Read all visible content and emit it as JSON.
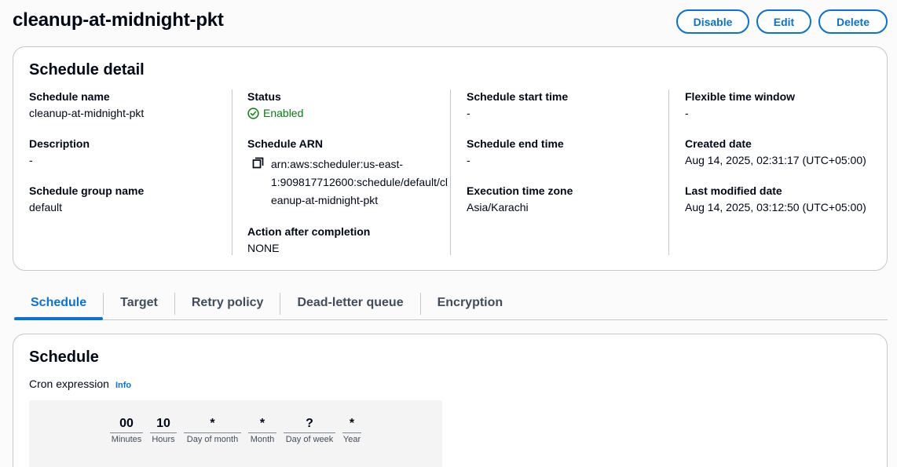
{
  "header": {
    "title": "cleanup-at-midnight-pkt",
    "disable_label": "Disable",
    "edit_label": "Edit",
    "delete_label": "Delete"
  },
  "detail": {
    "title": "Schedule detail",
    "schedule_name_label": "Schedule name",
    "schedule_name": "cleanup-at-midnight-pkt",
    "description_label": "Description",
    "description": "-",
    "group_label": "Schedule group name",
    "group": "default",
    "status_label": "Status",
    "status": "Enabled",
    "status_color": "#037f0c",
    "arn_label": "Schedule ARN",
    "arn_lines": [
      "arn:aws:scheduler:us-east-",
      "1:909817712600:schedule/default/cl",
      "eanup-at-midnight-pkt"
    ],
    "action_label": "Action after completion",
    "action": "NONE",
    "start_label": "Schedule start time",
    "start": "-",
    "end_label": "Schedule end time",
    "end": "-",
    "tz_label": "Execution time zone",
    "tz": "Asia/Karachi",
    "flex_label": "Flexible time window",
    "flex": "-",
    "created_label": "Created date",
    "created": "Aug 14, 2025, 02:31:17 (UTC+05:00)",
    "modified_label": "Last modified date",
    "modified": "Aug 14, 2025, 03:12:50 (UTC+05:00)"
  },
  "tabs": [
    {
      "label": "Schedule",
      "active": true
    },
    {
      "label": "Target"
    },
    {
      "label": "Retry policy"
    },
    {
      "label": "Dead-letter queue"
    },
    {
      "label": "Encryption"
    }
  ],
  "schedule": {
    "title": "Schedule",
    "cron_label": "Cron expression",
    "info_label": "Info",
    "fields": [
      {
        "value": "00",
        "label": "Minutes"
      },
      {
        "value": "10",
        "label": "Hours"
      },
      {
        "value": "*",
        "label": "Day of month"
      },
      {
        "value": "*",
        "label": "Month"
      },
      {
        "value": "?",
        "label": "Day of week"
      },
      {
        "value": "*",
        "label": "Year"
      }
    ]
  },
  "colors": {
    "accent": "#0972d3",
    "success": "#037f0c",
    "border": "#c6c6cd"
  },
  "icons": [
    "check-circle-icon",
    "copy-icon"
  ]
}
